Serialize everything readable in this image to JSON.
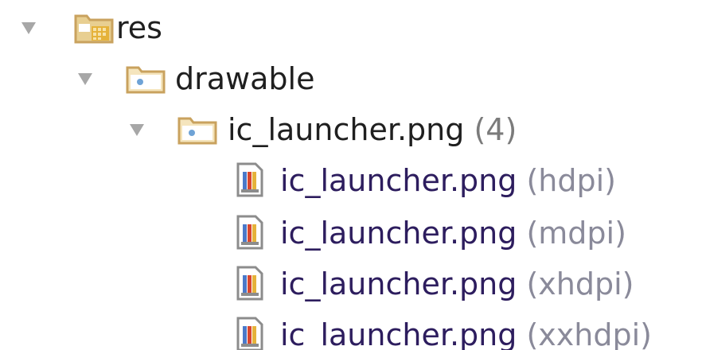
{
  "tree": {
    "res": {
      "label": "res",
      "icon": "resource-folder-icon"
    },
    "drawable": {
      "label": "drawable",
      "icon": "folder-icon"
    },
    "group": {
      "label": "ic_launcher.png",
      "qualifier": "(4)",
      "icon": "folder-icon"
    },
    "files": [
      {
        "label": "ic_launcher.png",
        "qualifier": "(hdpi)",
        "icon": "image-file-icon"
      },
      {
        "label": "ic_launcher.png",
        "qualifier": "(mdpi)",
        "icon": "image-file-icon"
      },
      {
        "label": "ic_launcher.png",
        "qualifier": "(xhdpi)",
        "icon": "image-file-icon"
      },
      {
        "label": "ic_launcher.png",
        "qualifier": "(xxhdpi)",
        "icon": "image-file-icon"
      }
    ]
  },
  "colors": {
    "folder": "#c9a25e",
    "folder_dot": "#6fa3d6",
    "arrow": "#a7a7a7",
    "qualifier_text": "#7b7b7b"
  }
}
